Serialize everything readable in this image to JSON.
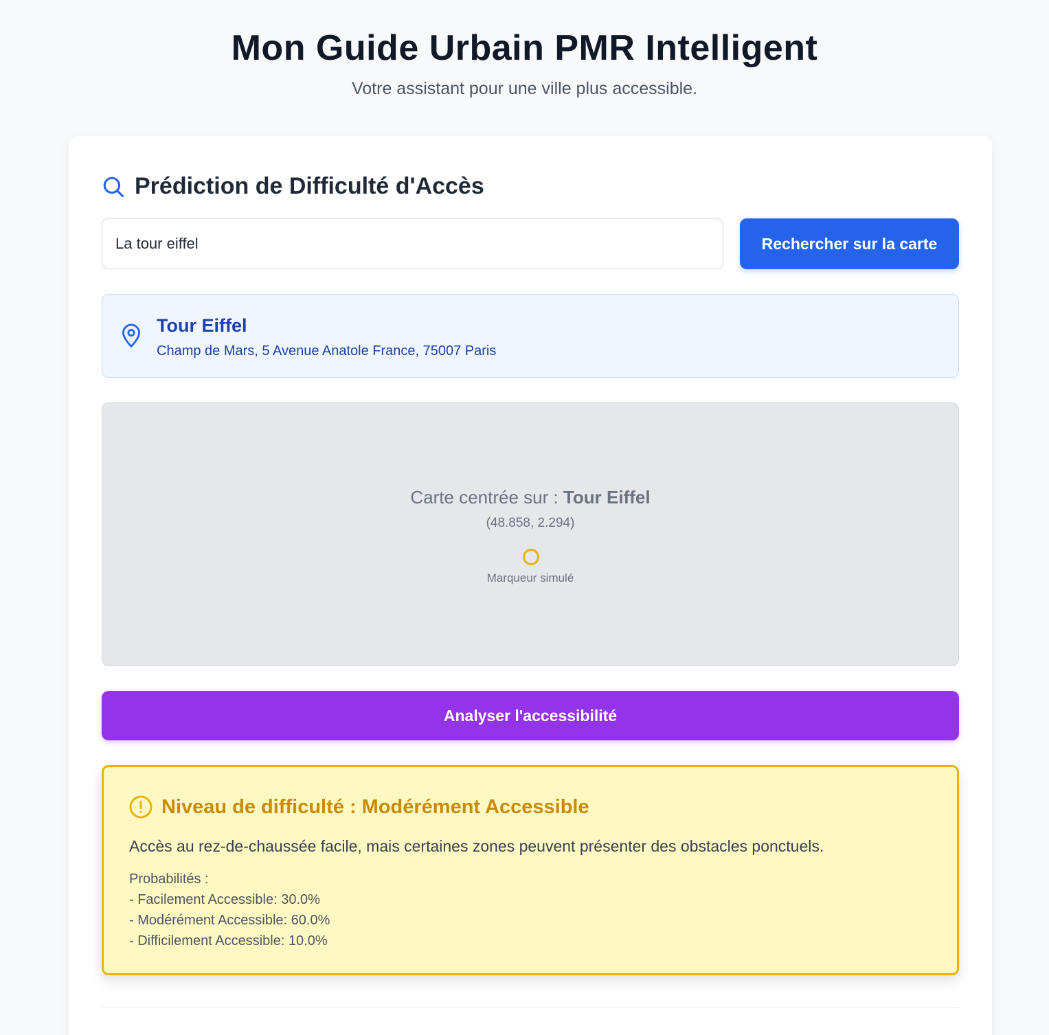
{
  "header": {
    "title": "Mon Guide Urbain PMR Intelligent",
    "subtitle": "Votre assistant pour une ville plus accessible."
  },
  "prediction": {
    "section_title": "Prédiction de Difficulté d'Accès",
    "search": {
      "value": "La tour eiffel",
      "button_label": "Rechercher sur la carte"
    },
    "location": {
      "name": "Tour Eiffel",
      "address": "Champ de Mars, 5 Avenue Anatole France, 75007 Paris"
    },
    "map": {
      "caption_prefix": "Carte centrée sur : ",
      "caption_place": "Tour Eiffel",
      "coords": "(48.858, 2.294)",
      "marker_label": "Marqueur simulé"
    },
    "analyze_button_label": "Analyser l'accessibilité",
    "result": {
      "title": "Niveau de difficulté : Modérément Accessible",
      "description": "Accès au rez-de-chaussée facile, mais certaines zones peuvent présenter des obstacles ponctuels.",
      "probabilities_header": "Probabilités :",
      "probabilities": [
        "- Facilement Accessible: 30.0%",
        "- Modérément Accessible: 60.0%",
        "- Difficilement Accessible: 10.0%"
      ]
    }
  },
  "colors": {
    "primary_blue": "#2563eb",
    "analyze_purple": "#9333ea",
    "warning_yellow": "#eab308",
    "warning_text": "#ca8a04",
    "result_bg": "#fef9c3",
    "location_bg": "#eff6ff",
    "location_text": "#1e40af"
  },
  "icons": {
    "section": "search-icon",
    "location": "map-pin-icon",
    "result": "alert-circle-icon",
    "map_marker": "map-marker-icon"
  }
}
